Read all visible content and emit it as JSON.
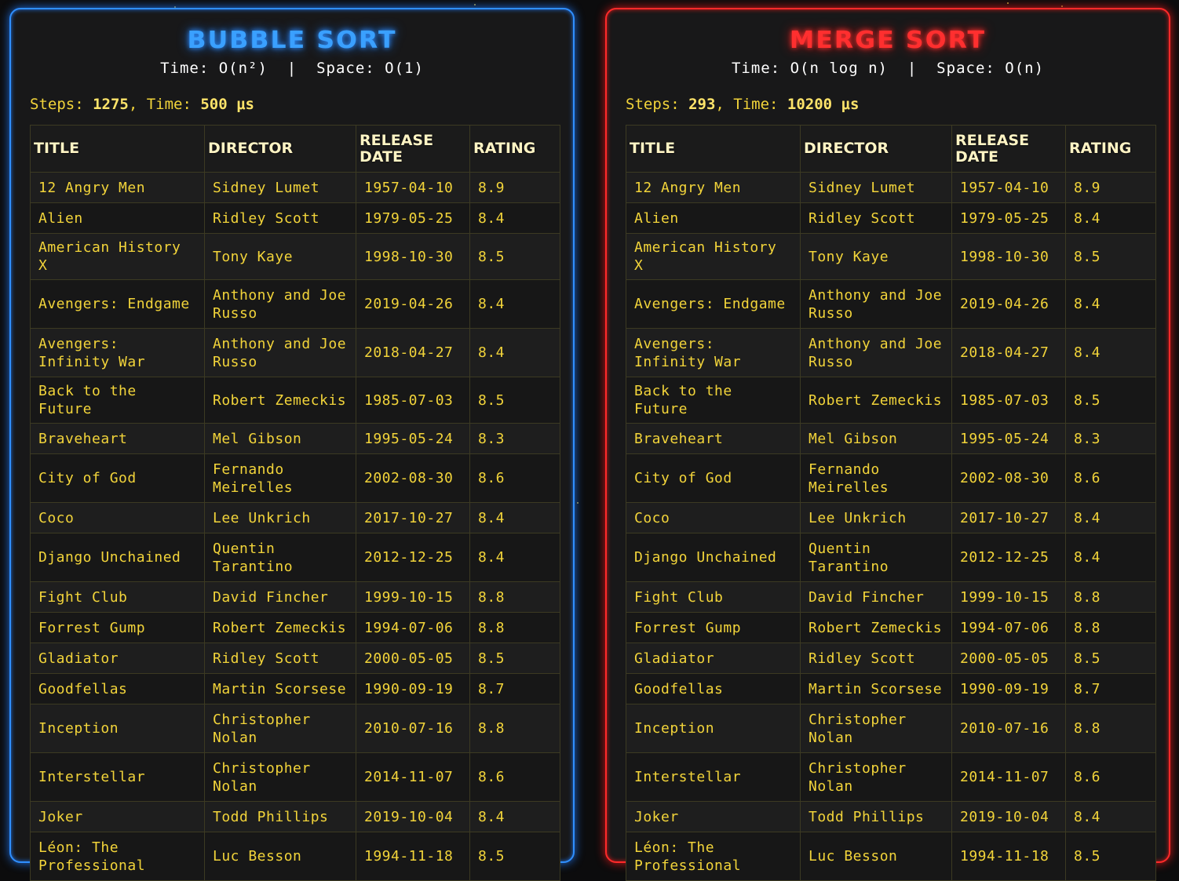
{
  "panels": [
    {
      "name": "BUBBLE SORT",
      "complexity": "Time: O(n²)  |  Space: O(1)",
      "steps_label": "Steps: ",
      "steps": "1275",
      "time_label": ", Time: ",
      "time": "500 μs"
    },
    {
      "name": "MERGE SORT",
      "complexity": "Time: O(n log n)  |  Space: O(n)",
      "steps_label": "Steps: ",
      "steps": "293",
      "time_label": ", Time: ",
      "time": "10200 μs"
    }
  ],
  "columns": [
    "TITLE",
    "DIRECTOR",
    "RELEASE DATE",
    "RATING"
  ],
  "rows": [
    {
      "title": "12 Angry Men",
      "director": "Sidney Lumet",
      "date": "1957-04-10",
      "rating": "8.9"
    },
    {
      "title": "Alien",
      "director": "Ridley Scott",
      "date": "1979-05-25",
      "rating": "8.4"
    },
    {
      "title": "American History X",
      "director": "Tony Kaye",
      "date": "1998-10-30",
      "rating": "8.5"
    },
    {
      "title": "Avengers: Endgame",
      "director": "Anthony and Joe Russo",
      "date": "2019-04-26",
      "rating": "8.4"
    },
    {
      "title": "Avengers: Infinity War",
      "director": "Anthony and Joe Russo",
      "date": "2018-04-27",
      "rating": "8.4"
    },
    {
      "title": "Back to the Future",
      "director": "Robert Zemeckis",
      "date": "1985-07-03",
      "rating": "8.5"
    },
    {
      "title": "Braveheart",
      "director": "Mel Gibson",
      "date": "1995-05-24",
      "rating": "8.3"
    },
    {
      "title": "City of God",
      "director": "Fernando Meirelles",
      "date": "2002-08-30",
      "rating": "8.6"
    },
    {
      "title": "Coco",
      "director": "Lee Unkrich",
      "date": "2017-10-27",
      "rating": "8.4"
    },
    {
      "title": "Django Unchained",
      "director": "Quentin Tarantino",
      "date": "2012-12-25",
      "rating": "8.4"
    },
    {
      "title": "Fight Club",
      "director": "David Fincher",
      "date": "1999-10-15",
      "rating": "8.8"
    },
    {
      "title": "Forrest Gump",
      "director": "Robert Zemeckis",
      "date": "1994-07-06",
      "rating": "8.8"
    },
    {
      "title": "Gladiator",
      "director": "Ridley Scott",
      "date": "2000-05-05",
      "rating": "8.5"
    },
    {
      "title": "Goodfellas",
      "director": "Martin Scorsese",
      "date": "1990-09-19",
      "rating": "8.7"
    },
    {
      "title": "Inception",
      "director": "Christopher Nolan",
      "date": "2010-07-16",
      "rating": "8.8"
    },
    {
      "title": "Interstellar",
      "director": "Christopher Nolan",
      "date": "2014-11-07",
      "rating": "8.6"
    },
    {
      "title": "Joker",
      "director": "Todd Phillips",
      "date": "2019-10-04",
      "rating": "8.4"
    },
    {
      "title": "Léon: The Professional",
      "director": "Luc Besson",
      "date": "1994-11-18",
      "rating": "8.5"
    }
  ],
  "colors": {
    "bubble_accent": "#2f8fff",
    "merge_accent": "#ff2a2a",
    "text_yellow": "#f2d43a",
    "background": "#0c0c0d"
  }
}
